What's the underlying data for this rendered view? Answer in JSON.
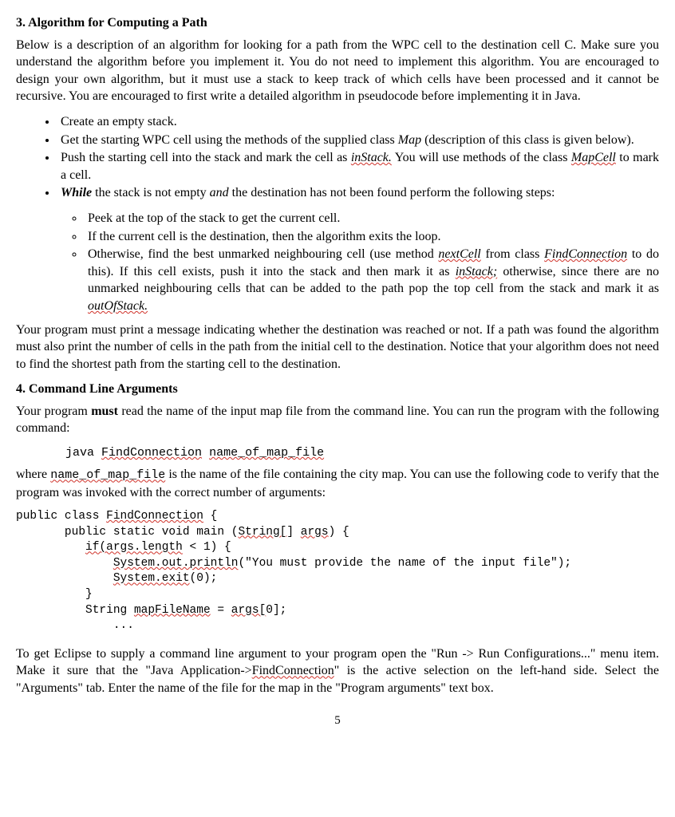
{
  "section3": {
    "heading": "3. Algorithm for Computing a Path",
    "intro": "Below is a description of an algorithm for looking for a path from the WPC cell to the destination cell C. Make sure you understand the algorithm before you implement it.  You do not need to implement this algorithm. You are encouraged to design your own algorithm, but it must use a stack to keep track of which cells have been processed and it cannot be recursive. You are encouraged to first write a detailed algorithm in pseudocode before implementing it in Java.",
    "bullets": {
      "b1": "Create an empty stack.",
      "b2_a": "Get the starting WPC cell using the methods of the supplied class ",
      "b2_map": "Map",
      "b2_b": " (description of this class is given below).",
      "b3_a": "Push the starting cell into the stack and mark the cell as ",
      "b3_instack": "inStack.",
      "b3_b": " You will use methods of the class ",
      "b3_mapcell": "MapCell",
      "b3_c": " to mark a cell.",
      "b4_a": "While",
      "b4_b": " the stack is not empty ",
      "b4_and": "and",
      "b4_c": " the destination has not been found perform the following steps:"
    },
    "inner": {
      "i1": "Peek at the top of the stack to get the current cell.",
      "i2": "If the current cell is the destination, then the algorithm exits the loop.",
      "i3_a": "Otherwise, find the best unmarked neighbouring cell (use method ",
      "i3_nextcell": "nextCell",
      "i3_b": " from class ",
      "i3_findconn": "FindConnection",
      "i3_c": " to do this). If this cell exists, push it into the stack and then mark it as ",
      "i3_instack": "inStack;",
      "i3_d": " otherwise, since there are no unmarked neighbouring cells that can be added to the path pop the top cell from the stack and mark it as ",
      "i3_outofstack": "outOfStack."
    },
    "closing": "Your program must print a message indicating whether the destination was reached or not. If a path was found the algorithm must also print the number of cells in the path from the initial cell to the destination. Notice that your algorithm does not need to find the shortest path from the starting cell to the destination."
  },
  "section4": {
    "heading": "4. Command Line Arguments",
    "p1_a": "Your program ",
    "p1_must": "must",
    "p1_b": " read the name of the input map file from the command line. You can run the program with the following command:",
    "cmd_java": "java ",
    "cmd_findconn": "FindConnection",
    "cmd_space": " ",
    "cmd_name": "name_of_map_file",
    "p2_a": "where ",
    "p2_name": "name_of_map_file",
    "p2_b": " is the name of the file containing the city map. You can use the following code to verify that the program was invoked with the correct number of arguments:",
    "code": {
      "l1_a": "public class ",
      "l1_b": "FindConnection",
      "l1_c": " {",
      "l2_a": "       public static void main (",
      "l2_b": "String[",
      "l2_c": "] ",
      "l2_d": "args",
      "l2_e": ") {",
      "l3_a": "          ",
      "l3_b": "if(args.length",
      "l3_c": " < 1) {",
      "l4_a": "              ",
      "l4_b": "System.out.println",
      "l4_c": "(\"You must provide the name of the input file\");",
      "l5_a": "              ",
      "l5_b": "System.exit",
      "l5_c": "(0);",
      "l6": "          }",
      "l7_a": "          String ",
      "l7_b": "mapFileName",
      "l7_c": " = ",
      "l7_d": "args[",
      "l7_e": "0];",
      "l8": "              ..."
    },
    "p3_a": "To get Eclipse to supply a command line argument to your program open the \"Run -> Run Configurations...\" menu item. Make it sure that the \"Java Application->",
    "p3_findconn": "FindConnection",
    "p3_b": "\" is the active selection on the left-hand side. Select the \"Arguments\" tab. Enter the name of the file for the map in the \"Program arguments\" text box."
  },
  "pagenum": "5"
}
